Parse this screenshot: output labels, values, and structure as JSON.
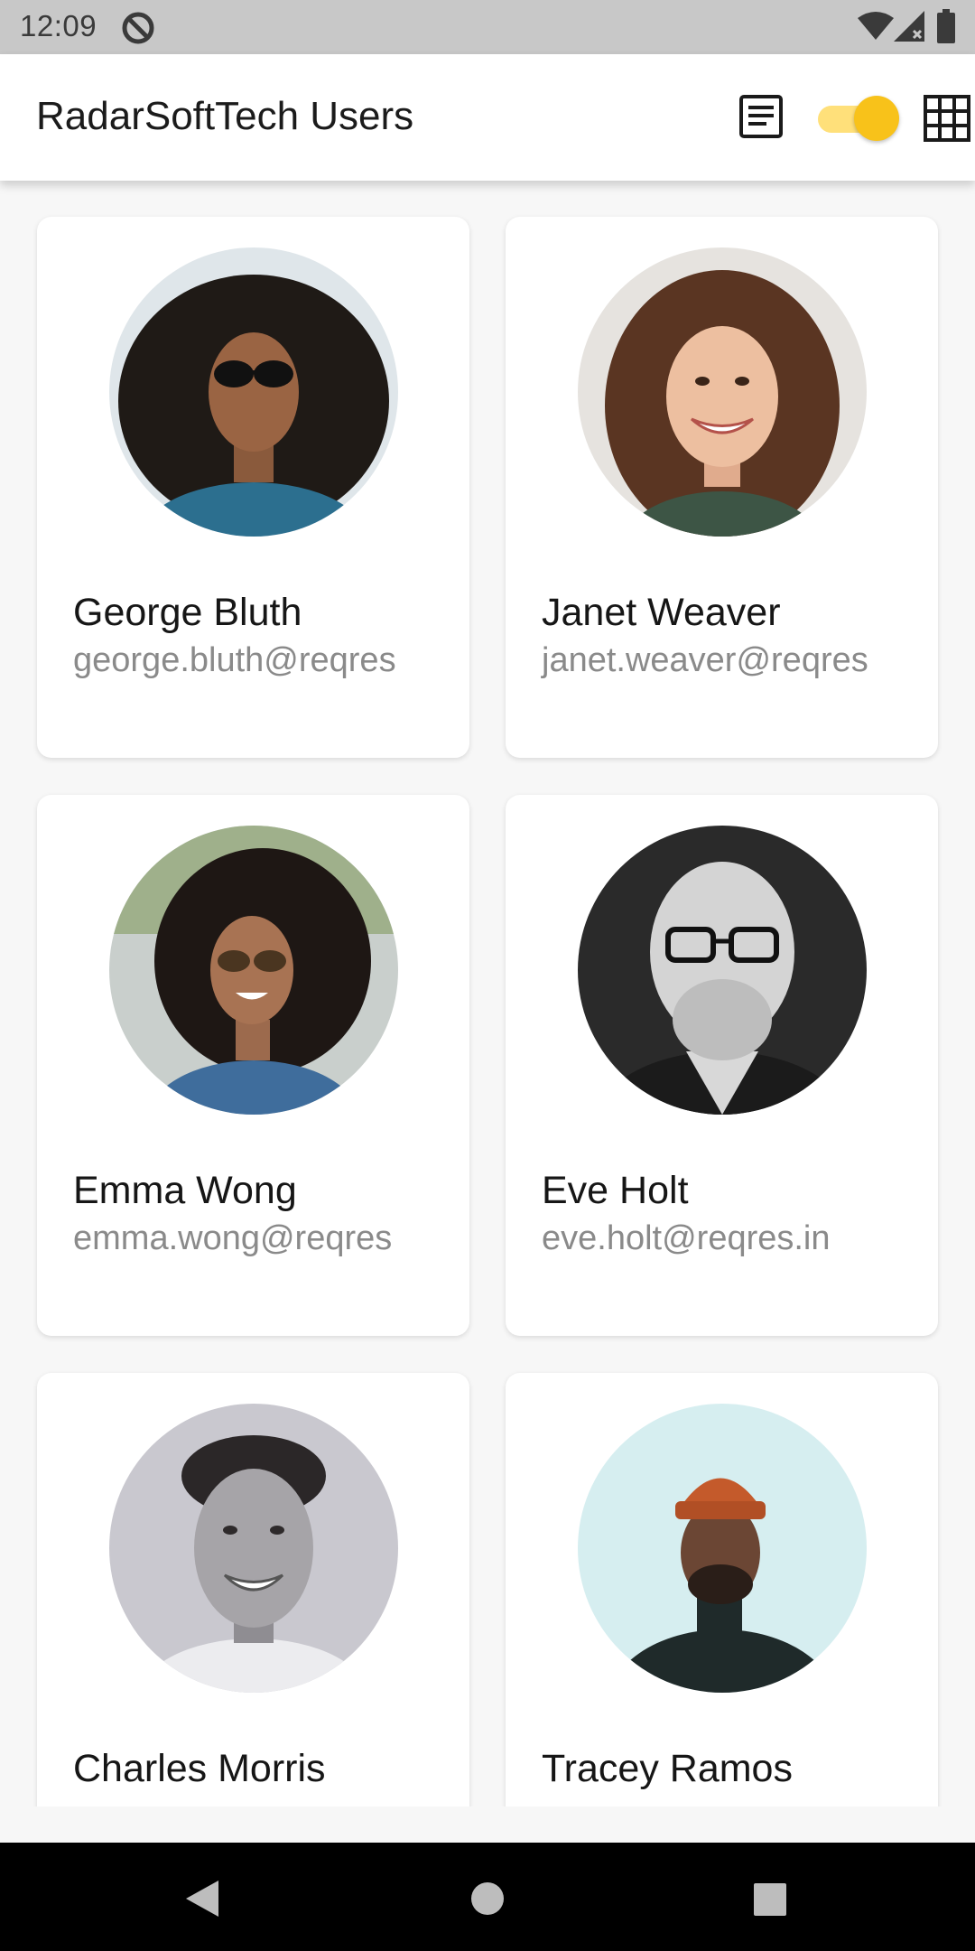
{
  "status_bar": {
    "time": "12:09",
    "icons": [
      "do-not-disturb-icon",
      "wifi-icon",
      "signal-icon",
      "battery-icon"
    ]
  },
  "app_bar": {
    "title": "RadarSoftTech Users",
    "list_view_icon": "list-view-icon",
    "view_toggle_on": true,
    "grid_view_icon": "grid-view-icon"
  },
  "colors": {
    "toggle_thumb": "#f8c21a",
    "toggle_track": "#ffe07a",
    "name_text": "#161616",
    "email_text": "#8a8a8a"
  },
  "users": [
    {
      "name": "George Bluth",
      "email": "george.bluth@reqres"
    },
    {
      "name": "Janet Weaver",
      "email": "janet.weaver@reqres"
    },
    {
      "name": "Emma Wong",
      "email": "emma.wong@reqres"
    },
    {
      "name": "Eve Holt",
      "email": "eve.holt@reqres.in"
    },
    {
      "name": "Charles Morris",
      "email": ""
    },
    {
      "name": "Tracey Ramos",
      "email": ""
    }
  ],
  "nav_bar": {
    "buttons": [
      "back-icon",
      "home-icon",
      "recents-icon"
    ]
  }
}
